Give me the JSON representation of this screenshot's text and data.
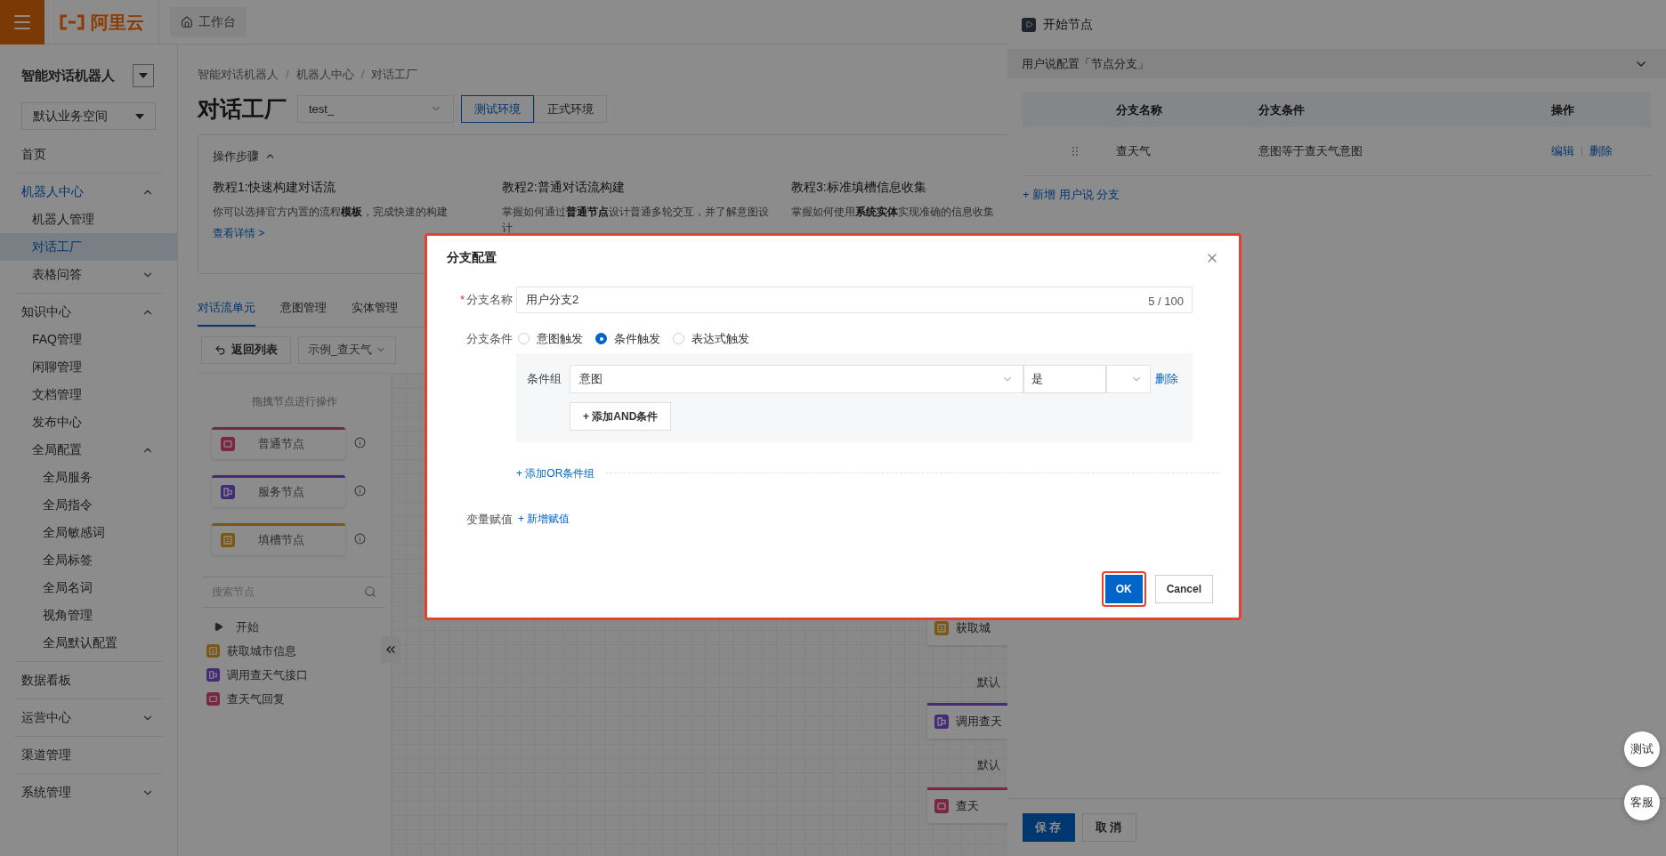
{
  "topbar": {
    "logo_text": "阿里云",
    "tab": "工作台"
  },
  "sidebar": {
    "title": "智能对话机器人",
    "workspace": "默认业务空间",
    "items": [
      {
        "label": "首页",
        "selected": false
      },
      {
        "label": "机器人中心",
        "expanded": true,
        "children": [
          {
            "label": "机器人管理",
            "selected": false
          },
          {
            "label": "对话工厂",
            "selected": true
          },
          {
            "label": "表格问答",
            "selected": false,
            "expanded": false
          }
        ]
      },
      {
        "label": "知识中心",
        "expanded": true,
        "children": [
          {
            "label": "FAQ管理",
            "selected": false
          },
          {
            "label": "闲聊管理",
            "selected": false
          },
          {
            "label": "文档管理",
            "selected": false
          },
          {
            "label": "发布中心",
            "selected": false
          },
          {
            "label": "全局配置",
            "expanded": true,
            "children": [
              {
                "label": "全局服务",
                "selected": false
              },
              {
                "label": "全局指令",
                "selected": false
              },
              {
                "label": "全局敏感词",
                "selected": false
              },
              {
                "label": "全局标签",
                "selected": false
              },
              {
                "label": "全局名词",
                "selected": false
              },
              {
                "label": "视角管理",
                "selected": false
              },
              {
                "label": "全局默认配置",
                "selected": false
              }
            ]
          }
        ]
      },
      {
        "label": "数据看板",
        "selected": false
      },
      {
        "label": "运营中心",
        "selected": false,
        "expanded": false
      },
      {
        "label": "渠道管理",
        "selected": false
      },
      {
        "label": "系统管理",
        "selected": false,
        "expanded": false
      }
    ]
  },
  "breadcrumb": [
    "智能对话机器人",
    "机器人中心",
    "对话工厂"
  ],
  "breadcrumb_separator": "/",
  "page_title": "对话工厂",
  "bot_select": {
    "value": "test_"
  },
  "environments": [
    {
      "label": "测试环境",
      "selected": true
    },
    {
      "label": "正式环境",
      "selected": false
    }
  ],
  "steps": {
    "title": "操作步骤",
    "expanded": true,
    "tutorials": [
      {
        "title": "教程1:快速构建对话流",
        "description": "你可以选择官方内置的流程**模板**，完成快速的构建",
        "link": "查看详情 >"
      },
      {
        "title": "教程2:普通对话流构建",
        "description": "掌握如何通过**普通节点**设计普通多轮交互，并了解意图设计"
      },
      {
        "title": "教程3:标准填槽信息收集",
        "description": "掌握如何使用**系统实体**实现准确的信息收集"
      }
    ]
  },
  "tabs": [
    {
      "label": "对话流单元",
      "selected": true
    },
    {
      "label": "意图管理",
      "selected": false
    },
    {
      "label": "实体管理",
      "selected": false
    }
  ],
  "toolbar": {
    "back_button": "返回列表",
    "flow_select": "示例_查天气"
  },
  "palette": {
    "hint": "拖拽节点进行操作",
    "nodes": [
      {
        "label": "普通节点",
        "kind": "normal"
      },
      {
        "label": "服务节点",
        "kind": "service"
      },
      {
        "label": "填槽节点",
        "kind": "slot"
      }
    ]
  },
  "node_search": {
    "placeholder": "搜索节点"
  },
  "node_tree": [
    {
      "label": "开始",
      "kind": "start"
    },
    {
      "label": "获取城市信息",
      "kind": "slot"
    },
    {
      "label": "调用查天气接口",
      "kind": "service"
    },
    {
      "label": "查天气回复",
      "kind": "normal"
    }
  ],
  "canvas_nodes": [
    {
      "kind": "slot",
      "label": "获取城"
    },
    {
      "kind": "edge_label",
      "label": "默认"
    },
    {
      "kind": "service",
      "label": "调用查天"
    },
    {
      "kind": "edge_label",
      "label": "默认"
    },
    {
      "kind": "normal",
      "label": "查天"
    }
  ],
  "drawer": {
    "title": "开始节点",
    "section": {
      "title": "用户说配置「节点分支」",
      "expanded": true
    },
    "table": {
      "columns": [
        "分支名称",
        "分支条件",
        "操作"
      ],
      "rows": [
        {
          "name": "查天气",
          "condition": "意图等于查天气意图",
          "actions": [
            "编辑",
            "删除"
          ]
        }
      ]
    },
    "add_link": "+ 新增 用户说 分支",
    "buttons": [
      {
        "label": "保存",
        "primary": true
      },
      {
        "label": "取消",
        "primary": false
      }
    ]
  },
  "float_buttons": [
    "测试",
    "客服"
  ],
  "modal": {
    "title": "分支配置",
    "highlighted": true,
    "name_field": {
      "label": "分支名称",
      "required_mark": "*",
      "value": "用户分支2",
      "counter": "5 / 100"
    },
    "condition": {
      "label": "分支条件",
      "options": [
        {
          "label": "意图触发",
          "selected": false
        },
        {
          "label": "条件触发",
          "selected": true
        },
        {
          "label": "表达式触发",
          "selected": false
        }
      ],
      "group": {
        "label": "条件组",
        "field": "意图",
        "operator": "是",
        "delete": "删除",
        "add_and": "+ 添加AND条件"
      },
      "add_or": "+ 添加OR条件组"
    },
    "variables": {
      "label": "变量赋值",
      "add": "+ 新增赋值"
    },
    "buttons": [
      {
        "label": "OK",
        "primary": true,
        "highlighted": true
      },
      {
        "label": "Cancel",
        "primary": false,
        "highlighted": false
      }
    ]
  }
}
